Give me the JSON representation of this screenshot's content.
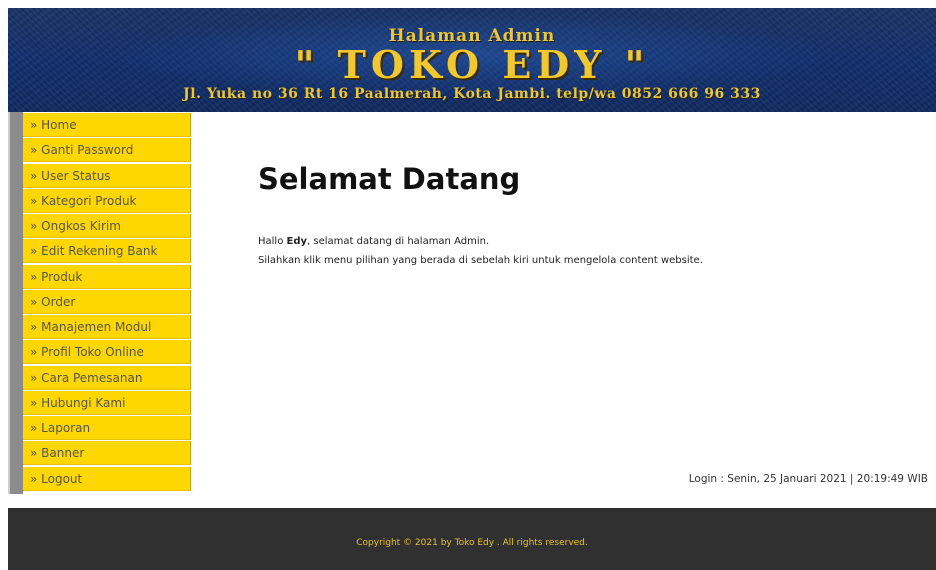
{
  "header": {
    "line1": "Halaman Admin",
    "line2": "\" TOKO EDY \"",
    "line3": "Jl. Yuka no 36 Rt 16 Paalmerah, Kota Jambi. telp/wa 0852 666 96 333"
  },
  "sidebar": {
    "items": [
      {
        "label": "» Home"
      },
      {
        "label": "» Ganti Password"
      },
      {
        "label": "» User Status"
      },
      {
        "label": "» Kategori Produk"
      },
      {
        "label": "» Ongkos Kirim"
      },
      {
        "label": "» Edit Rekening Bank"
      },
      {
        "label": "» Produk"
      },
      {
        "label": "» Order"
      },
      {
        "label": "» Manajemen Modul"
      },
      {
        "label": "» Profil Toko Online"
      },
      {
        "label": "» Cara Pemesanan"
      },
      {
        "label": "» Hubungi Kami"
      },
      {
        "label": "» Laporan"
      },
      {
        "label": "» Banner"
      },
      {
        "label": "» Logout"
      }
    ]
  },
  "main": {
    "title": "Selamat Datang",
    "greeting_prefix": "Hallo ",
    "username": "Edy",
    "greeting_suffix": ", selamat datang di halaman Admin.",
    "instruction": "Silahkan klik menu pilihan yang berada di sebelah kiri untuk mengelola content website.",
    "login_info": "Login : Senin, 25 Januari 2021 | 20:19:49 WIB"
  },
  "footer": {
    "copyright": "Copyright © 2021 by Toko Edy . All rights reserved."
  },
  "colors": {
    "menu_bg": "#ffd700",
    "banner_text": "#f0c830",
    "footer_bg": "#303030",
    "footer_text": "#e6c22a"
  }
}
